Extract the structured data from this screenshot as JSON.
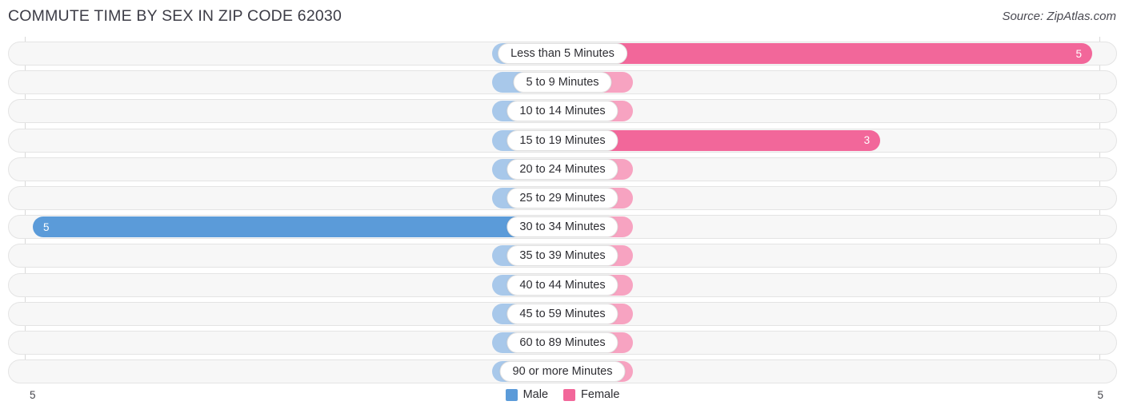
{
  "header": {
    "title": "COMMUTE TIME BY SEX IN ZIP CODE 62030",
    "source": "Source: ZipAtlas.com"
  },
  "legend": {
    "male_label": "Male",
    "female_label": "Female",
    "male_color": "#5b9bd9",
    "female_color": "#f2679a"
  },
  "axis": {
    "left_label": "5",
    "right_label": "5",
    "max": 5
  },
  "chart_data": {
    "type": "bar",
    "title": "COMMUTE TIME BY SEX IN ZIP CODE 62030",
    "subtitle": "Source: ZipAtlas.com",
    "orientation": "horizontal-diverging",
    "xlabel": "",
    "ylabel": "",
    "xlim": [
      5,
      5
    ],
    "grid": false,
    "legend_position": "bottom-center",
    "categories": [
      "Less than 5 Minutes",
      "5 to 9 Minutes",
      "10 to 14 Minutes",
      "15 to 19 Minutes",
      "20 to 24 Minutes",
      "25 to 29 Minutes",
      "30 to 34 Minutes",
      "35 to 39 Minutes",
      "40 to 44 Minutes",
      "45 to 59 Minutes",
      "60 to 89 Minutes",
      "90 or more Minutes"
    ],
    "series": [
      {
        "name": "Male",
        "color": "#5b9bd9",
        "values": [
          0,
          0,
          0,
          0,
          0,
          0,
          5,
          0,
          0,
          0,
          0,
          0
        ]
      },
      {
        "name": "Female",
        "color": "#f2679a",
        "values": [
          5,
          0,
          0,
          3,
          0,
          0,
          0,
          0,
          0,
          0,
          0,
          0
        ]
      }
    ]
  },
  "rows": [
    {
      "label": "Less than 5 Minutes",
      "male": "0",
      "female": "5"
    },
    {
      "label": "5 to 9 Minutes",
      "male": "0",
      "female": "0"
    },
    {
      "label": "10 to 14 Minutes",
      "male": "0",
      "female": "0"
    },
    {
      "label": "15 to 19 Minutes",
      "male": "0",
      "female": "3"
    },
    {
      "label": "20 to 24 Minutes",
      "male": "0",
      "female": "0"
    },
    {
      "label": "25 to 29 Minutes",
      "male": "0",
      "female": "0"
    },
    {
      "label": "30 to 34 Minutes",
      "male": "5",
      "female": "0"
    },
    {
      "label": "35 to 39 Minutes",
      "male": "0",
      "female": "0"
    },
    {
      "label": "40 to 44 Minutes",
      "male": "0",
      "female": "0"
    },
    {
      "label": "45 to 59 Minutes",
      "male": "0",
      "female": "0"
    },
    {
      "label": "60 to 89 Minutes",
      "male": "0",
      "female": "0"
    },
    {
      "label": "90 or more Minutes",
      "male": "0",
      "female": "0"
    }
  ]
}
